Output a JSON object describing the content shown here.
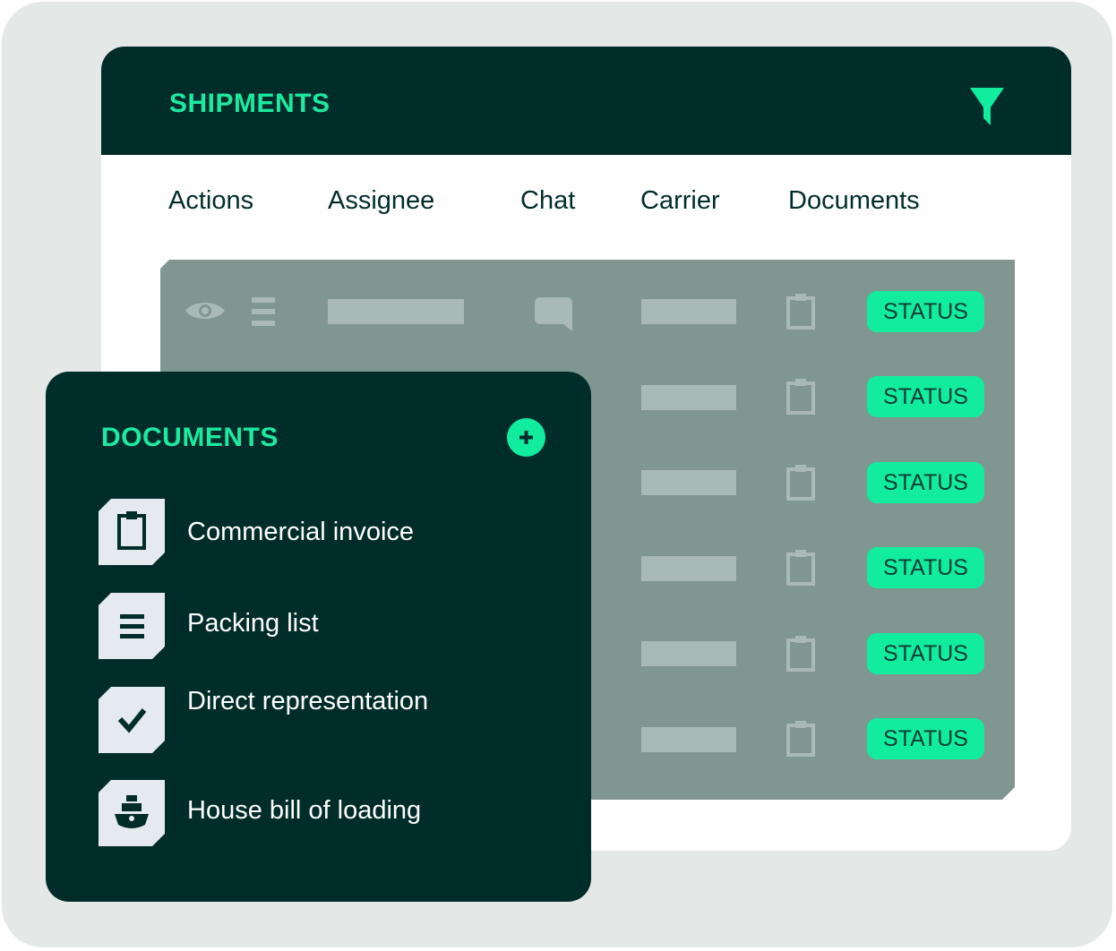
{
  "shipments": {
    "title": "SHIPMENTS",
    "filter_icon": "funnel-icon",
    "columns": [
      "Actions",
      "Assignee",
      "Chat",
      "Carrier",
      "Documents"
    ],
    "rows": [
      {
        "status": "STATUS"
      },
      {
        "status": "STATUS"
      },
      {
        "status": "STATUS"
      },
      {
        "status": "STATUS"
      },
      {
        "status": "STATUS"
      },
      {
        "status": "STATUS"
      }
    ]
  },
  "documents": {
    "title": "DOCUMENTS",
    "add_icon": "plus-icon",
    "items": [
      {
        "label": "Commercial invoice",
        "icon": "clipboard-icon"
      },
      {
        "label": "Packing list",
        "icon": "list-icon"
      },
      {
        "label": "Direct representation",
        "icon": "checkmark-icon"
      },
      {
        "label": "House bill of loading",
        "icon": "ship-icon"
      }
    ]
  },
  "colors": {
    "dark": "#002d2a",
    "accent": "#12ec9f",
    "table": "#809691",
    "placeholder": "#a9b9b5",
    "background": "#e4e8e6"
  }
}
